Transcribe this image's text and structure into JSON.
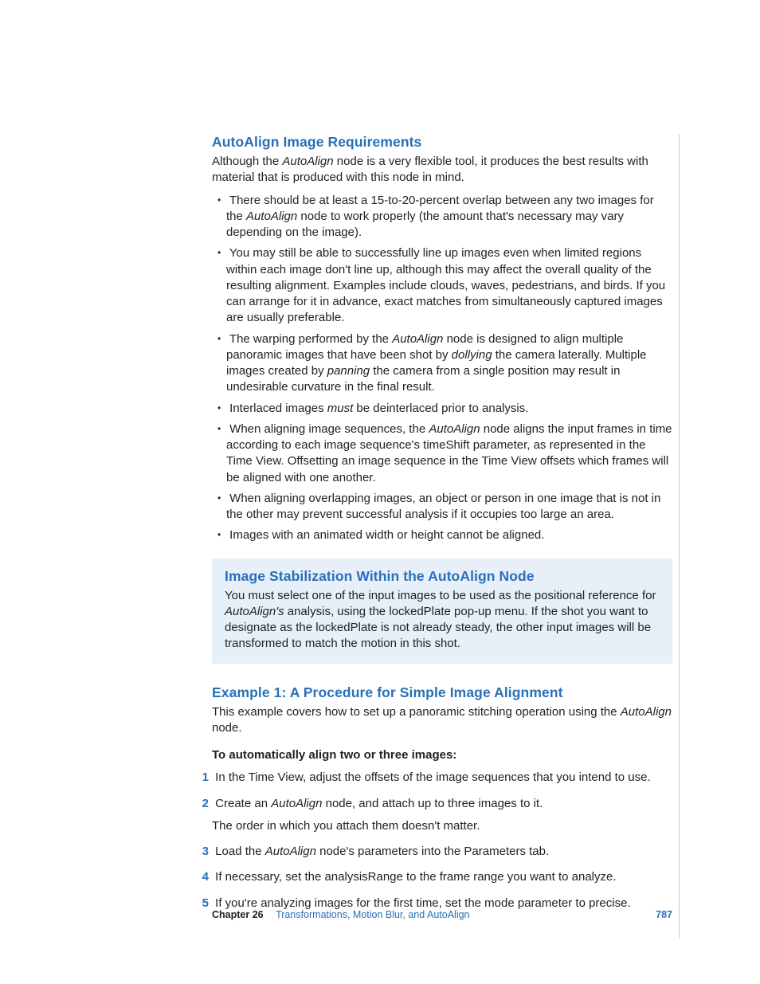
{
  "section1": {
    "heading": "AutoAlign Image Requirements",
    "intro_pre": "Although the ",
    "intro_em": "AutoAlign",
    "intro_post": " node is a very flexible tool, it produces the best results with material that is produced with this node in mind.",
    "bullets": [
      {
        "pre": "There should be at least a 15-to-20-percent overlap between any two images for the ",
        "em": "AutoAlign",
        "post": " node to work properly (the amount that's necessary may vary depending on the image)."
      },
      {
        "text": "You may still be able to successfully line up images even when limited regions within each image don't line up, although this may affect the overall quality of the resulting alignment. Examples include clouds, waves, pedestrians, and birds. If you can arrange for it in advance, exact matches from simultaneously captured images are usually preferable."
      },
      {
        "pre": "The warping performed by the ",
        "em1": "AutoAlign",
        "mid1": " node is designed to align multiple panoramic images that have been shot by ",
        "em2": "dollying",
        "mid2": " the camera laterally. Multiple images created by ",
        "em3": "panning",
        "post": " the camera from a single position may result in undesirable curvature in the final result."
      },
      {
        "pre": "Interlaced images ",
        "em": "must",
        "post": " be deinterlaced prior to analysis."
      },
      {
        "pre": "When aligning image sequences, the ",
        "em": "AutoAlign",
        "post": " node aligns the input frames in time according to each image sequence's timeShift parameter, as represented in the Time View. Offsetting an image sequence in the Time View offsets which frames will be aligned with one another."
      },
      {
        "text": "When aligning overlapping images, an object or person in one image that is not in the other may prevent successful analysis if it occupies too large an area."
      },
      {
        "text": "Images with an animated width or height cannot be aligned."
      }
    ]
  },
  "callout": {
    "heading": "Image Stabilization Within the AutoAlign Node",
    "body_pre": "You must select one of the input images to be used as the positional reference for ",
    "body_em": "AutoAlign's",
    "body_post": " analysis, using the lockedPlate pop-up menu. If the shot you want to designate as the lockedPlate is not already steady, the other input images will be transformed to match the motion in this shot."
  },
  "section2": {
    "heading": "Example 1:  A Procedure for Simple Image Alignment",
    "intro_pre": "This example covers how to set up a panoramic stitching operation using the ",
    "intro_em": "AutoAlign",
    "intro_post": " node.",
    "lead": "To automatically align two or three images:",
    "steps": [
      {
        "text": "In the Time View, adjust the offsets of the image sequences that you intend to use."
      },
      {
        "pre": "Create an ",
        "em": "AutoAlign",
        "post": " node, and attach up to three images to it.",
        "sub": "The order in which you attach them doesn't matter."
      },
      {
        "pre": "Load the ",
        "em": "AutoAlign",
        "post": " node's parameters into the Parameters tab."
      },
      {
        "text": "If necessary, set the analysisRange to the frame range you want to analyze."
      },
      {
        "text": "If you're analyzing images for the first time, set the mode parameter to precise."
      }
    ]
  },
  "footer": {
    "chapter_label": "Chapter 26",
    "chapter_title": "Transformations, Motion Blur, and AutoAlign",
    "page": "787"
  }
}
